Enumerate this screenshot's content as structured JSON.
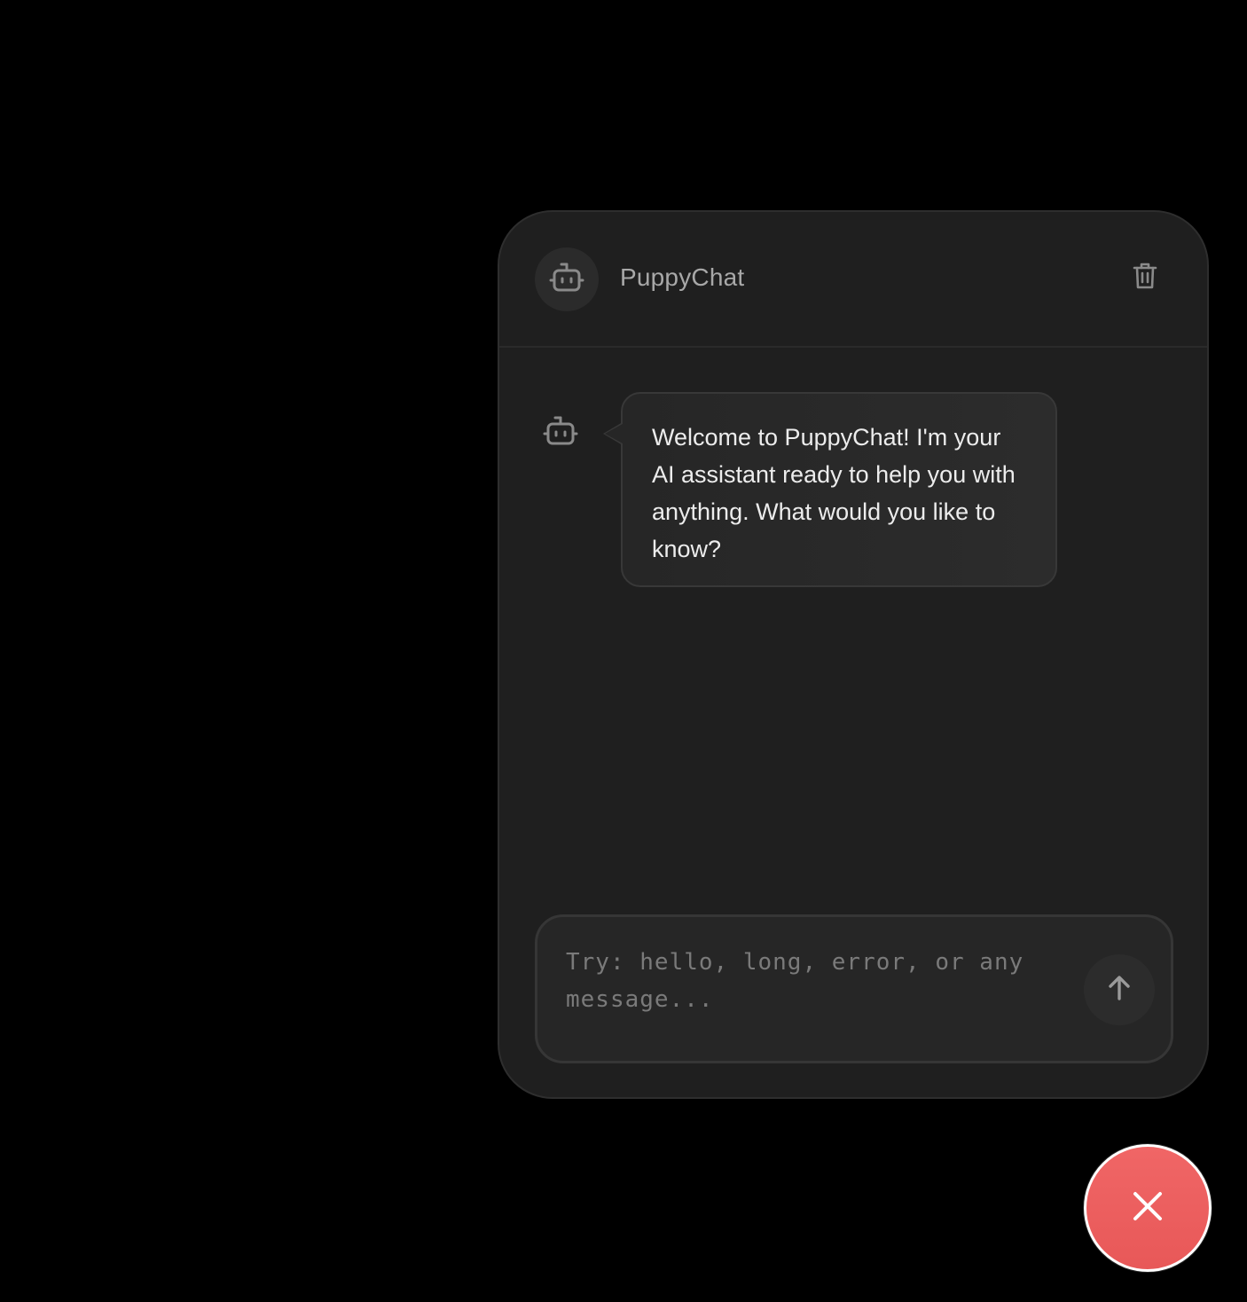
{
  "header": {
    "title": "PuppyChat",
    "avatar_icon": "robot-icon",
    "clear_icon": "trash-icon"
  },
  "messages": [
    {
      "role": "assistant",
      "icon": "robot-icon",
      "text": "Welcome to PuppyChat! I'm your AI assistant ready to help you with anything. What would you like to know?"
    }
  ],
  "composer": {
    "placeholder": "Try: hello, long, error, or any message...",
    "value": "",
    "send_icon": "arrow-up-icon"
  },
  "fab": {
    "icon": "close-icon",
    "color": "#ee5f5f"
  },
  "colors": {
    "page_background": "#000000",
    "panel_background": "#1f1f1f",
    "bubble_background": "#282828",
    "accent_close": "#ee5f5f"
  }
}
